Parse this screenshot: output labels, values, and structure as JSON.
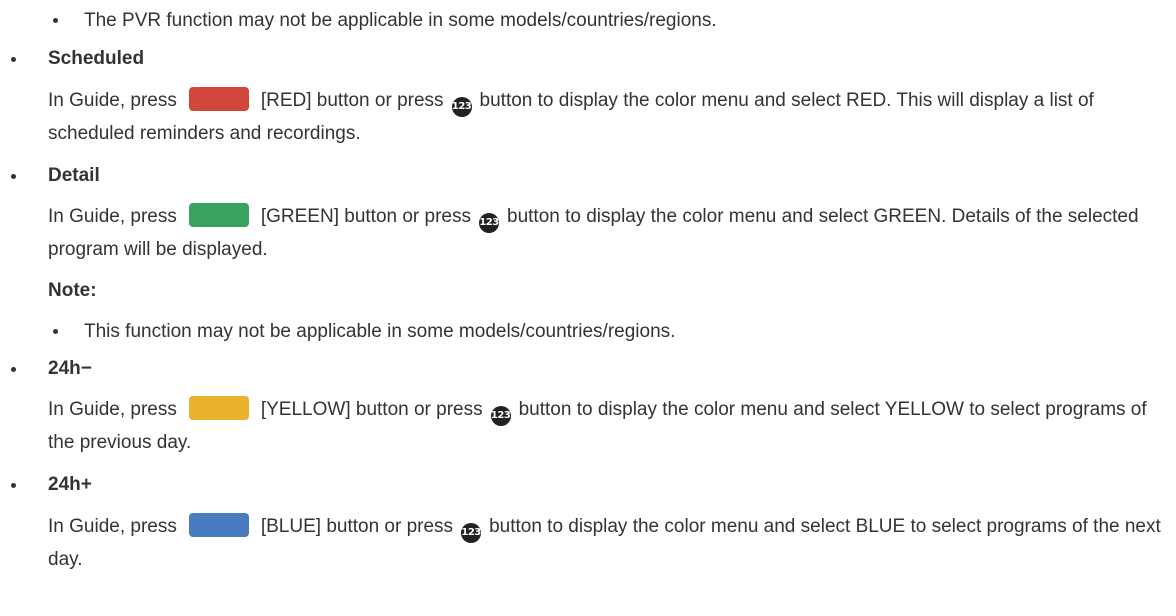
{
  "pvr_note": "The PVR function may not be applicable in some models/countries/regions.",
  "sections": [
    {
      "heading": "Scheduled",
      "pre": "In Guide, press",
      "button_label": "[RED] button or press",
      "post": "button to display the color menu and select RED. This will display a list of scheduled reminders and recordings.",
      "color": "#d2473b"
    },
    {
      "heading": "Detail",
      "pre": "In Guide, press",
      "button_label": "[GREEN] button or press",
      "post": "button to display the color menu and select GREEN. Details of the selected program will be displayed.",
      "color": "#3aa260"
    },
    {
      "heading": "24h−",
      "pre": "In Guide, press",
      "button_label": "[YELLOW] button or press",
      "post": "button to display the color menu and select YELLOW to select programs of the previous day.",
      "color": "#eab32b"
    },
    {
      "heading": "24h+",
      "pre": "In Guide, press",
      "button_label": "[BLUE] button or press",
      "post": "button to display the color menu and select BLUE to select programs of the next day.",
      "color": "#4a7bbf"
    }
  ],
  "note": {
    "label": "Note:",
    "item": "This function may not be applicable in some models/countries/regions."
  },
  "icons": {
    "color_button": "swatch",
    "number_button": "123-icon",
    "number_glyph": "123"
  }
}
